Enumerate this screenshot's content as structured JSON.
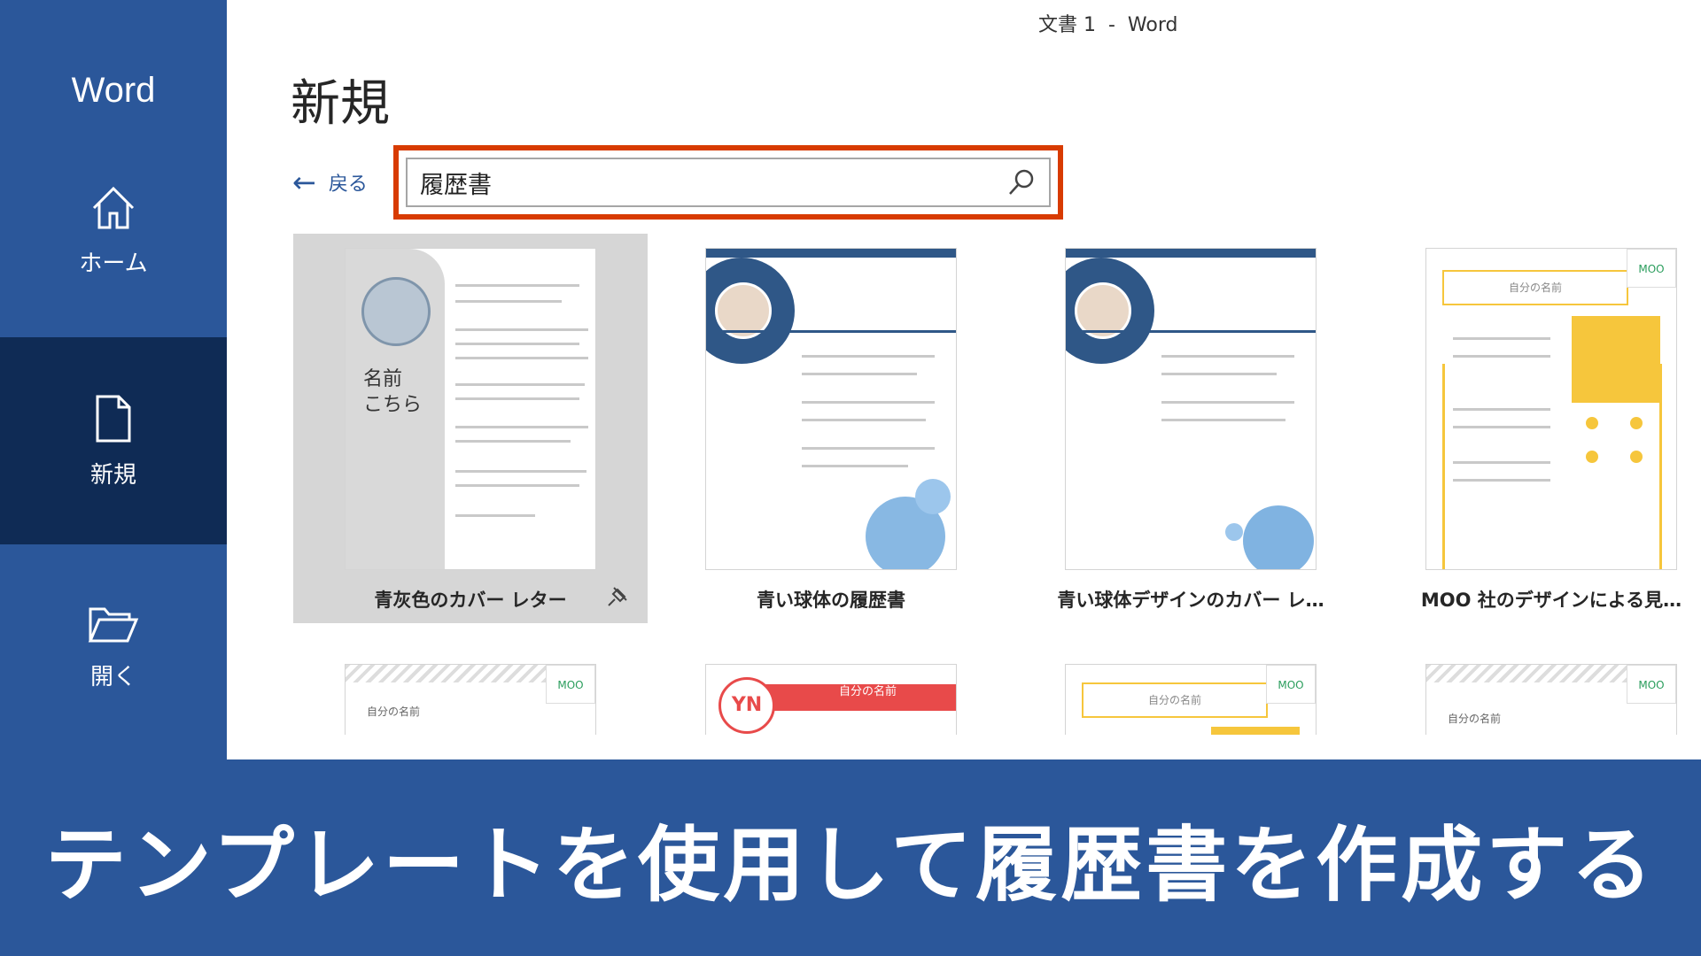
{
  "window": {
    "title": "文書 1  -  Word"
  },
  "sidebar": {
    "app_name": "Word",
    "items": [
      {
        "label": "ホーム",
        "icon": "home-icon"
      },
      {
        "label": "新規",
        "icon": "new-document-icon",
        "selected": true
      },
      {
        "label": "開く",
        "icon": "open-folder-icon"
      }
    ]
  },
  "main": {
    "title": "新規",
    "back_label": "戻る",
    "search": {
      "value": "履歴書"
    },
    "templates": [
      {
        "label": "青灰色のカバー レター",
        "selected": true,
        "thumb": {
          "name": "名前",
          "sub": "こちら"
        }
      },
      {
        "label": "青い球体の履歴書"
      },
      {
        "label": "青い球体デザインのカバー レ…"
      },
      {
        "label": "MOO 社のデザインによる見…",
        "thumb": {
          "brand": "MOO",
          "name": "自分の名前"
        }
      }
    ],
    "templates_row2": [
      {
        "thumb": {
          "brand": "MOO",
          "name": "自分の名前"
        }
      },
      {
        "thumb": {
          "initials": "YN",
          "name": "自分の名前"
        }
      },
      {
        "thumb": {
          "brand": "MOO",
          "name": "自分の名前"
        }
      },
      {
        "thumb": {
          "brand": "MOO",
          "name": "自分の名前"
        }
      }
    ]
  },
  "banner": {
    "text": "テンプレートを使用して履歴書を作成する"
  },
  "colors": {
    "brand": "#2b579a",
    "sidebar_selected": "#0f2b55",
    "search_highlight": "#d83b01"
  }
}
